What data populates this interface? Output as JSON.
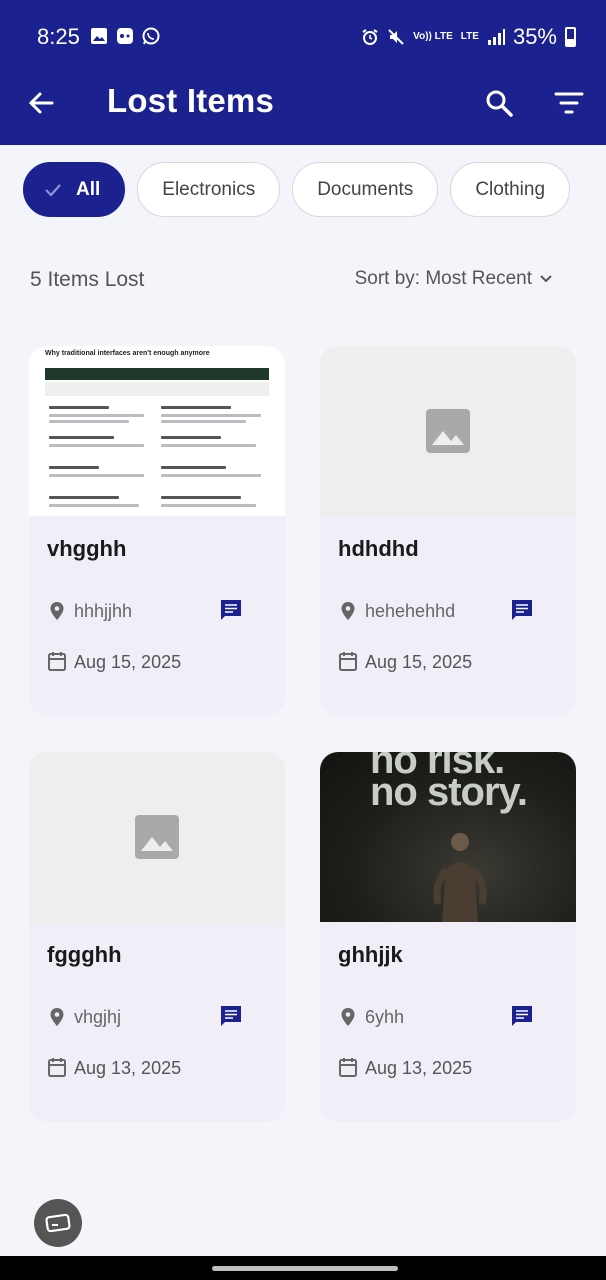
{
  "status_bar": {
    "time": "8:25",
    "network_top": "Vo)) LTE",
    "network_bottom": "LTE",
    "battery": "35%"
  },
  "app_bar": {
    "title": "Lost Items",
    "back_icon": "arrow-back-icon",
    "search_icon": "search-icon",
    "filter_icon": "filter-icon"
  },
  "filters": [
    {
      "label": "All",
      "selected": true
    },
    {
      "label": "Electronics",
      "selected": false
    },
    {
      "label": "Documents",
      "selected": false
    },
    {
      "label": "Clothing",
      "selected": false
    }
  ],
  "summary": {
    "count_label": "5 Items Lost",
    "sort_label": "Sort by: Most Recent"
  },
  "items": [
    {
      "name": "vhgghh",
      "location": "hhhjjhh",
      "date": "Aug 15, 2025",
      "image": "document-screenshot"
    },
    {
      "name": "hdhdhd",
      "location": "hehehehhd",
      "date": "Aug 15, 2025",
      "image": "placeholder"
    },
    {
      "name": "fggghh",
      "location": "vhgjhj",
      "date": "Aug 13, 2025",
      "image": "placeholder"
    },
    {
      "name": "ghhjjk",
      "location": "6yhh",
      "date": "Aug 13, 2025",
      "image": "poster"
    }
  ],
  "thumb_doc": {
    "heading": "Why traditional interfaces aren't enough anymore"
  },
  "thumb_poster": {
    "line1": "no risk.",
    "line2": "no story."
  },
  "colors": {
    "primary": "#1b2290",
    "card_bg": "#f1eef8",
    "page_bg": "#f4f5fa"
  }
}
